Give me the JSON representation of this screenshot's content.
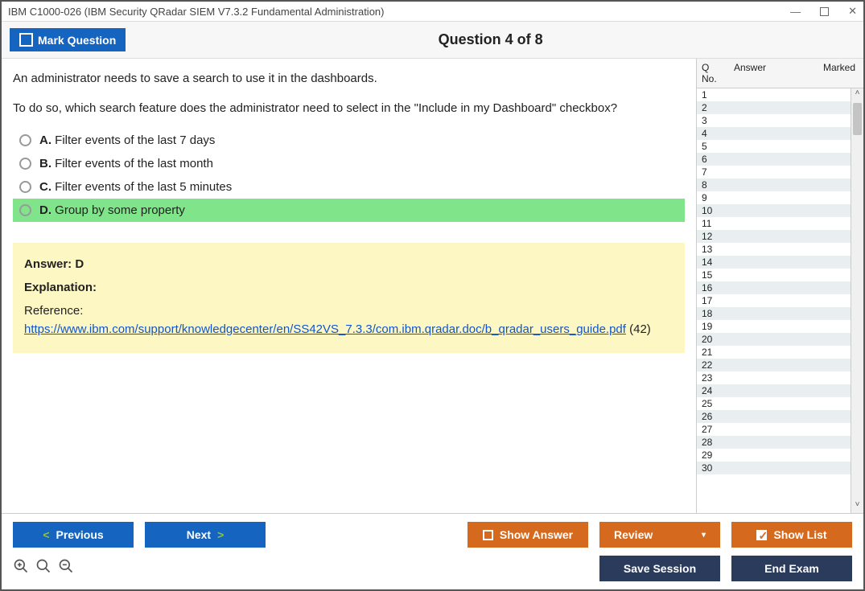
{
  "window": {
    "title": "IBM C1000-026 (IBM Security QRadar SIEM V7.3.2 Fundamental Administration)"
  },
  "header": {
    "mark_label": "Mark Question",
    "question_title": "Question 4 of 8"
  },
  "question": {
    "para1": "An administrator needs to save a search to use it in the dashboards.",
    "para2": "To do so, which search feature does the administrator need to select in the \"Include in my Dashboard\" checkbox?",
    "options": [
      {
        "letter": "A.",
        "text": "Filter events of the last 7 days",
        "correct": false
      },
      {
        "letter": "B.",
        "text": "Filter events of the last month",
        "correct": false
      },
      {
        "letter": "C.",
        "text": "Filter events of the last 5 minutes",
        "correct": false
      },
      {
        "letter": "D.",
        "text": "Group by some property",
        "correct": true
      }
    ]
  },
  "answer": {
    "line": "Answer: D",
    "explanation_label": "Explanation:",
    "reference_prefix": "Reference: ",
    "reference_url": "https://www.ibm.com/support/knowledgecenter/en/SS42VS_7.3.3/com.ibm.qradar.doc/b_qradar_users_guide.pdf",
    "reference_suffix": " (42)"
  },
  "sidebar": {
    "headers": {
      "qno": "Q No.",
      "answer": "Answer",
      "marked": "Marked"
    },
    "rows": [
      "1",
      "2",
      "3",
      "4",
      "5",
      "6",
      "7",
      "8",
      "9",
      "10",
      "11",
      "12",
      "13",
      "14",
      "15",
      "16",
      "17",
      "18",
      "19",
      "20",
      "21",
      "22",
      "23",
      "24",
      "25",
      "26",
      "27",
      "28",
      "29",
      "30"
    ]
  },
  "footer": {
    "previous": "Previous",
    "next": "Next",
    "show_answer": "Show Answer",
    "review": "Review",
    "show_list": "Show List",
    "save_session": "Save Session",
    "end_exam": "End Exam"
  }
}
